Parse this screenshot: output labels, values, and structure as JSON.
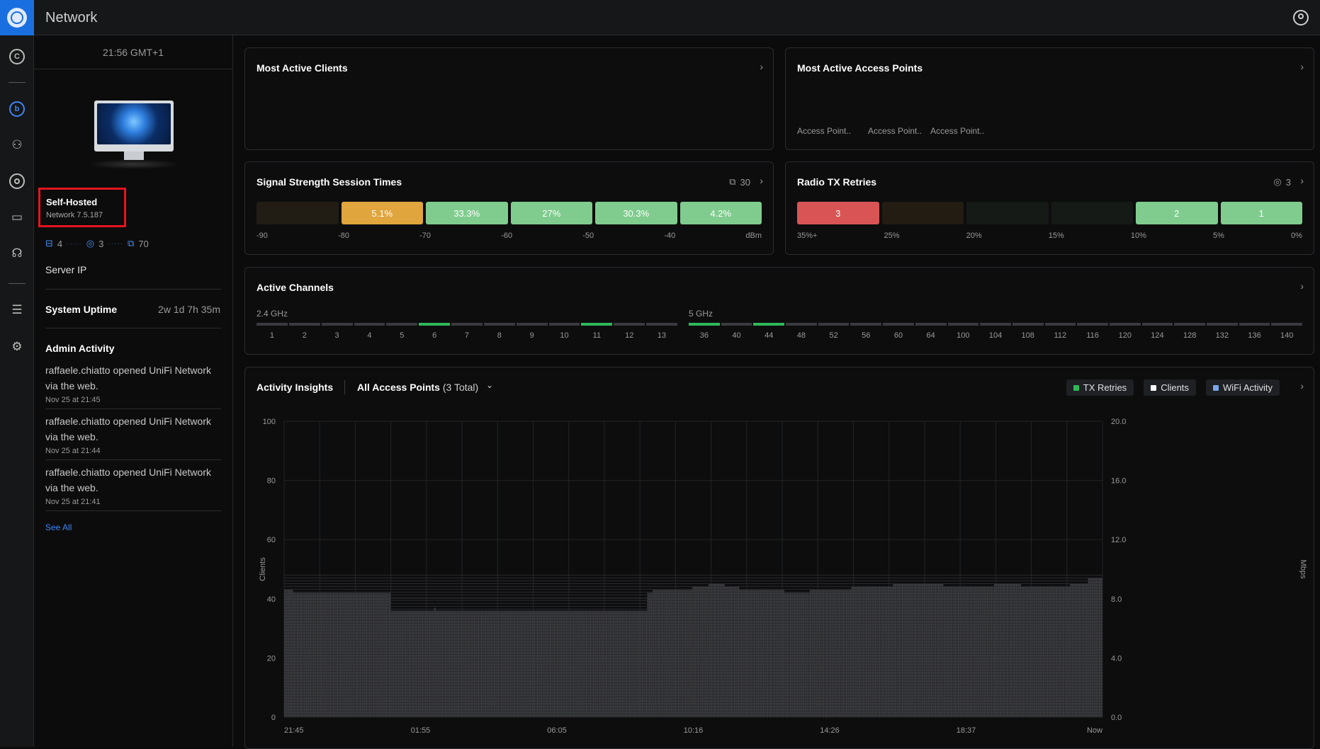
{
  "app": {
    "title": "Network"
  },
  "sidebar_icons": [
    "dashboard-icon",
    "wifi-icon",
    "topology-icon",
    "clients-icon",
    "devices-icon",
    "insights-icon",
    "logs-icon",
    "settings-icon"
  ],
  "left": {
    "clock": "21:56 GMT+1",
    "host_title": "Self-Hosted",
    "host_version": "Network 7.5.187",
    "stats": {
      "gateways": "4",
      "aps": "3",
      "clients": "70"
    },
    "server_ip_label": "Server IP",
    "uptime_label": "System Uptime",
    "uptime_value": "2w 1d 7h 35m",
    "admin_activity_label": "Admin Activity",
    "activity": [
      {
        "text": "raffaele.chiatto opened UniFi Network via the web.",
        "time": "Nov 25 at 21:45"
      },
      {
        "text": "raffaele.chiatto opened UniFi Network via the web.",
        "time": "Nov 25 at 21:44"
      },
      {
        "text": "raffaele.chiatto opened UniFi Network via the web.",
        "time": "Nov 25 at 21:41"
      }
    ],
    "see_all": "See All"
  },
  "cards": {
    "most_active_clients": {
      "title": "Most Active Clients"
    },
    "most_active_aps": {
      "title": "Most Active Access Points",
      "labels": [
        "Access Point..",
        "Access Point..",
        "Access Point.."
      ]
    },
    "signal": {
      "title": "Signal Strength Session Times",
      "count": "30",
      "segments": [
        {
          "label": "",
          "color": "#221d14"
        },
        {
          "label": "5.1%",
          "color": "#e0a53c"
        },
        {
          "label": "33.3%",
          "color": "#7fcc8e"
        },
        {
          "label": "27%",
          "color": "#7fcc8e"
        },
        {
          "label": "30.3%",
          "color": "#7fcc8e"
        },
        {
          "label": "4.2%",
          "color": "#7fcc8e"
        }
      ],
      "axis": [
        "-90",
        "-80",
        "-70",
        "-60",
        "-50",
        "-40",
        "dBm"
      ]
    },
    "radio_tx": {
      "title": "Radio TX Retries",
      "count": "3",
      "segments": [
        {
          "label": "3",
          "color": "#d95555"
        },
        {
          "label": "",
          "color": "#231c12"
        },
        {
          "label": "",
          "color": "#161a17"
        },
        {
          "label": "",
          "color": "#161a17"
        },
        {
          "label": "2",
          "color": "#7fcc8e"
        },
        {
          "label": "1",
          "color": "#7fcc8e"
        }
      ],
      "axis": [
        "35%+",
        "25%",
        "20%",
        "15%",
        "10%",
        "5%",
        "0%"
      ]
    },
    "active_channels": {
      "title": "Active Channels",
      "band24_label": "2.4 GHz",
      "band5_label": "5 GHz",
      "ch24": [
        "1",
        "2",
        "3",
        "4",
        "5",
        "6",
        "7",
        "8",
        "9",
        "10",
        "11",
        "12",
        "13"
      ],
      "ch24_active": [
        "6",
        "11"
      ],
      "ch5": [
        "36",
        "40",
        "44",
        "48",
        "52",
        "56",
        "60",
        "64",
        "100",
        "104",
        "108",
        "112",
        "116",
        "120",
        "124",
        "128",
        "132",
        "136",
        "140"
      ],
      "ch5_active": [
        "36",
        "44"
      ]
    },
    "activity_insights": {
      "title": "Activity Insights",
      "selector_bold": "All Access Points",
      "selector_light": "(3 Total)",
      "legend": [
        {
          "label": "TX Retries",
          "color": "#2fb85a"
        },
        {
          "label": "Clients",
          "color": "#ffffff"
        },
        {
          "label": "WiFi Activity",
          "color": "#7aa7e8"
        }
      ]
    }
  },
  "chart_data": {
    "type": "bar",
    "ylabel": "Clients",
    "y2label": "Mbps",
    "ylim": [
      0,
      100
    ],
    "y2lim": [
      0,
      20
    ],
    "yticks": [
      "0",
      "20",
      "40",
      "60",
      "80",
      "100"
    ],
    "y2ticks": [
      "0.0",
      "4.0",
      "8.0",
      "12.0",
      "16.0",
      "20.0"
    ],
    "xticks": [
      "21:45",
      "01:55",
      "06:05",
      "10:16",
      "14:26",
      "18:37",
      "Now"
    ],
    "series": [
      {
        "name": "Clients",
        "values": [
          43,
          43,
          43,
          43,
          43,
          42,
          42,
          42,
          42,
          42,
          42,
          42,
          42,
          42,
          42,
          42,
          42,
          42,
          42,
          42,
          42,
          42,
          42,
          42,
          42,
          42,
          42,
          42,
          42,
          42,
          42,
          42,
          42,
          42,
          42,
          42,
          42,
          42,
          42,
          42,
          42,
          42,
          42,
          42,
          42,
          42,
          42,
          42,
          42,
          42,
          42,
          42,
          42,
          42,
          42,
          42,
          42,
          42,
          42,
          36,
          36,
          36,
          36,
          36,
          36,
          36,
          36,
          36,
          36,
          36,
          36,
          36,
          36,
          36,
          36,
          36,
          36,
          36,
          36,
          36,
          36,
          36,
          36,
          37,
          36,
          36,
          36,
          36,
          36,
          36,
          36,
          36,
          36,
          36,
          36,
          36,
          36,
          36,
          36,
          36,
          36,
          36,
          36,
          36,
          36,
          36,
          36,
          36,
          36,
          36,
          36,
          36,
          36,
          36,
          36,
          36,
          36,
          36,
          36,
          36,
          36,
          36,
          36,
          36,
          36,
          36,
          36,
          36,
          36,
          36,
          36,
          36,
          36,
          36,
          36,
          36,
          36,
          36,
          36,
          36,
          36,
          36,
          36,
          36,
          36,
          36,
          36,
          36,
          36,
          36,
          36,
          36,
          36,
          36,
          36,
          36,
          36,
          36,
          36,
          36,
          36,
          36,
          36,
          36,
          36,
          36,
          36,
          36,
          36,
          36,
          36,
          36,
          36,
          36,
          36,
          36,
          36,
          36,
          36,
          36,
          36,
          36,
          36,
          36,
          36,
          36,
          36,
          36,
          36,
          36,
          36,
          36,
          36,
          36,
          36,
          36,
          36,
          36,
          36,
          36,
          36,
          42,
          42,
          42,
          43,
          43,
          43,
          43,
          43,
          43,
          43,
          43,
          43,
          43,
          43,
          43,
          43,
          43,
          43,
          43,
          43,
          43,
          43,
          43,
          43,
          43,
          44,
          44,
          44,
          44,
          44,
          44,
          44,
          44,
          44,
          45,
          45,
          45,
          45,
          45,
          45,
          45,
          45,
          45,
          44,
          44,
          44,
          44,
          44,
          44,
          44,
          44,
          43,
          43,
          43,
          43,
          43,
          43,
          43,
          43,
          43,
          43,
          43,
          43,
          43,
          43,
          43,
          43,
          43,
          43,
          43,
          43,
          43,
          43,
          43,
          43,
          43,
          42,
          42,
          42,
          42,
          42,
          42,
          42,
          42,
          42,
          42,
          42,
          42,
          42,
          42,
          43,
          43,
          43,
          43,
          43,
          43,
          43,
          43,
          43,
          43,
          43,
          43,
          43,
          43,
          43,
          43,
          43,
          43,
          43,
          43,
          43,
          43,
          43,
          44,
          44,
          44,
          44,
          44,
          44,
          44,
          44,
          44,
          44,
          44,
          44,
          44,
          44,
          44,
          44,
          44,
          44,
          44,
          44,
          44,
          44,
          44,
          45,
          45,
          45,
          45,
          45,
          45,
          45,
          45,
          45,
          45,
          45,
          45,
          45,
          45,
          45,
          45,
          45,
          45,
          45,
          45,
          45,
          45,
          45,
          45,
          45,
          45,
          45,
          45,
          44,
          44,
          44,
          44,
          44,
          44,
          44,
          44,
          44,
          44,
          44,
          44,
          44,
          44,
          44,
          44,
          44,
          44,
          44,
          44,
          44,
          44,
          44,
          44,
          44,
          44,
          44,
          44,
          45,
          45,
          45,
          45,
          45,
          45,
          45,
          45,
          45,
          45,
          45,
          45,
          45,
          45,
          45,
          44,
          44,
          44,
          44,
          44,
          44,
          44,
          44,
          44,
          44,
          44,
          44,
          44,
          44,
          44,
          44,
          44,
          44,
          44,
          44,
          44,
          44,
          44,
          44,
          44,
          44,
          44,
          45,
          45,
          45,
          45,
          45,
          45,
          45,
          45,
          45,
          45,
          47,
          47,
          47,
          47,
          47,
          47,
          47,
          47
        ]
      }
    ]
  }
}
